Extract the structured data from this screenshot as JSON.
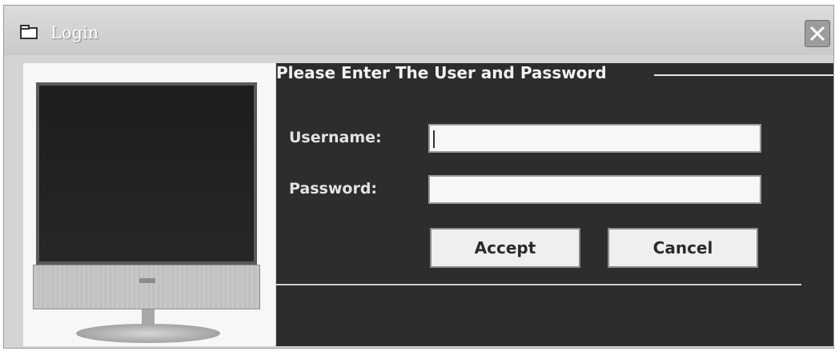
{
  "window": {
    "title": "Login",
    "icons": {
      "window_icon": "window-icon",
      "close_icon": "close-icon"
    }
  },
  "image": {
    "description_icon": "monitor-image"
  },
  "form": {
    "group_title": "Please Enter The User and Password",
    "username_label": "Username:",
    "username_value": "",
    "password_label": "Password:",
    "password_value": "",
    "accept_label": "Accept",
    "cancel_label": "Cancel"
  },
  "colors": {
    "panel": "#2d2d2d",
    "titlebar": "#d4d4d4",
    "field": "#f7f7f7"
  }
}
